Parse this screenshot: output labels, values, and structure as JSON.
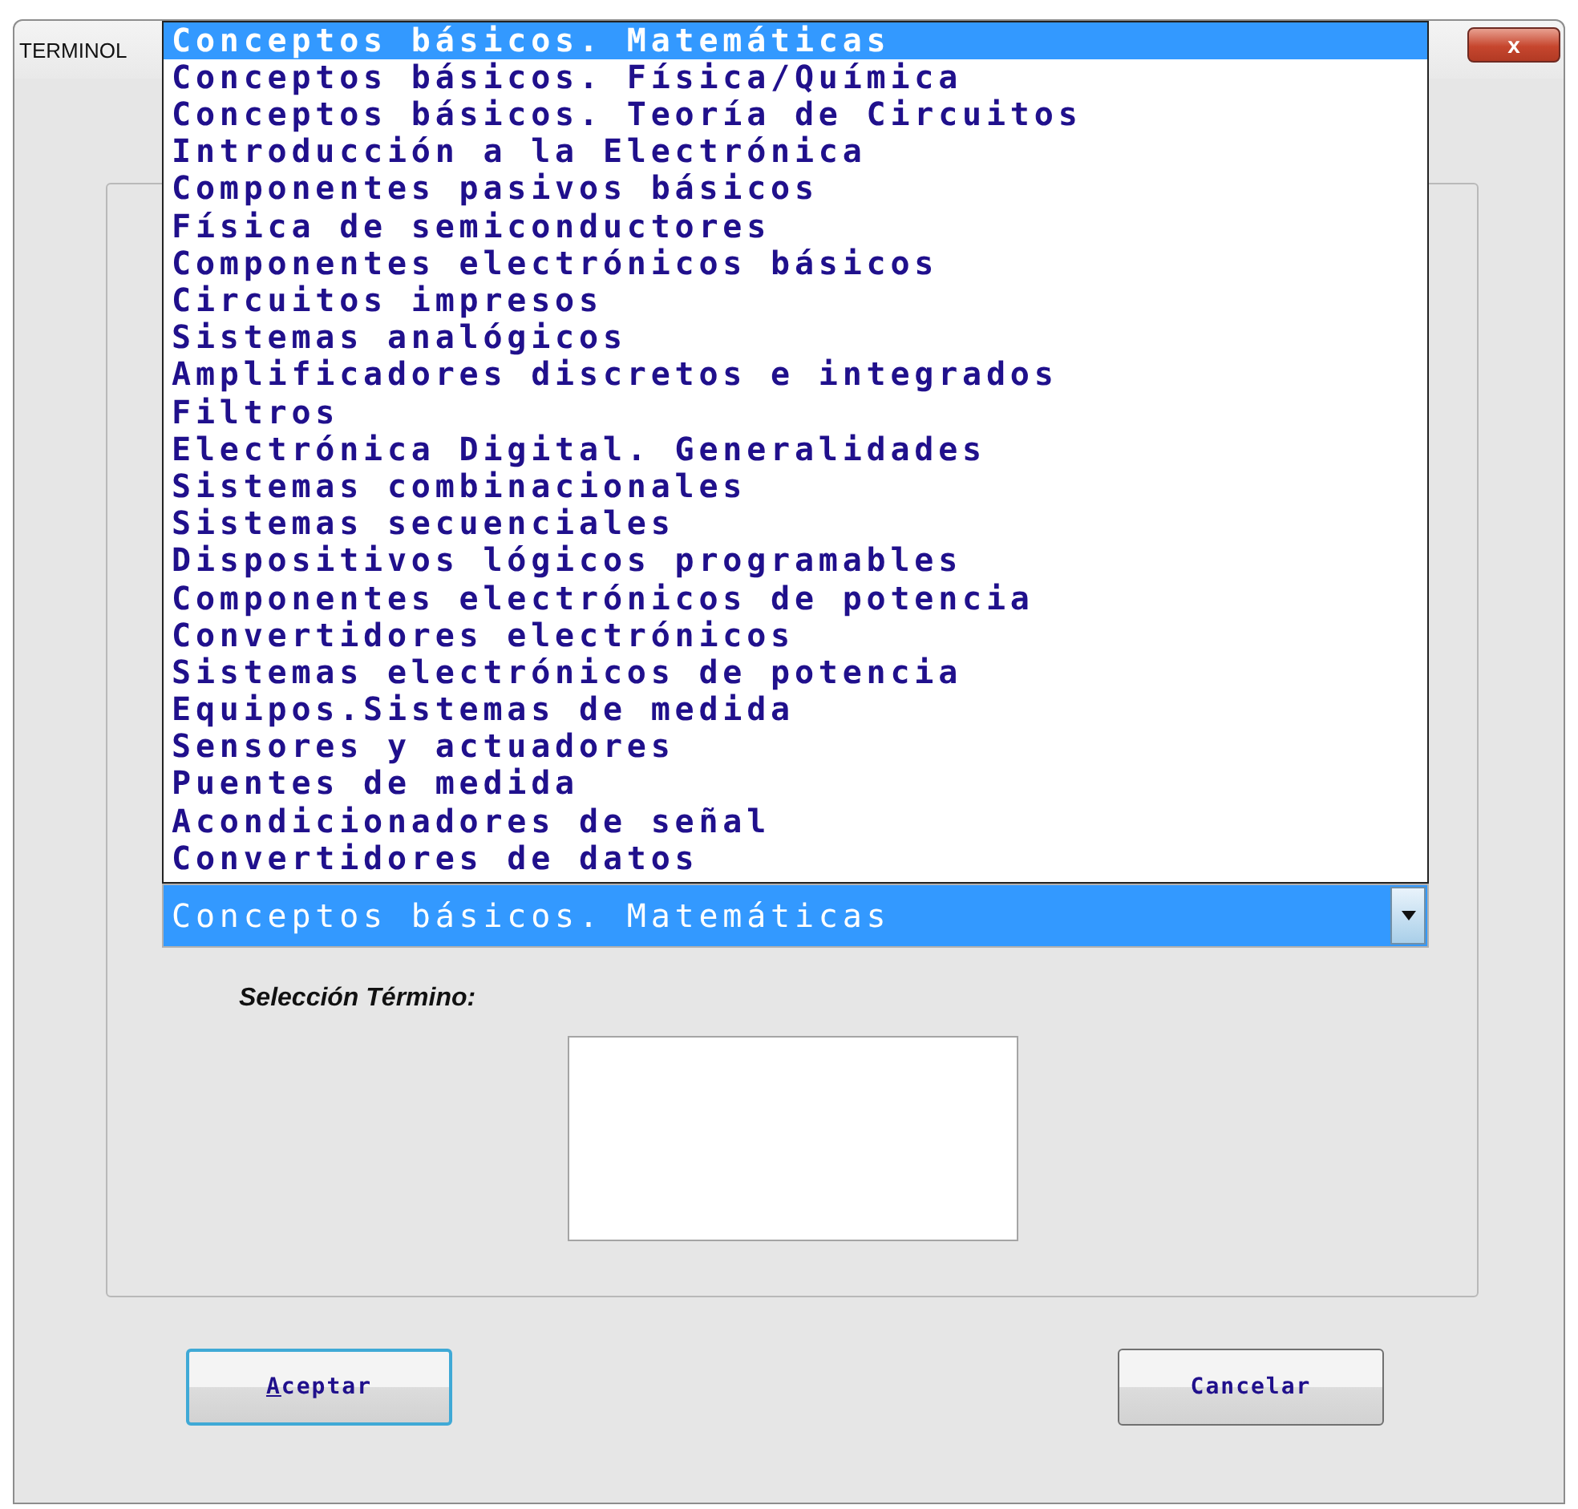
{
  "window": {
    "title": "TERMINOL",
    "close": "x"
  },
  "category_dropdown": {
    "value": "Conceptos básicos. Matemáticas",
    "expanded": true,
    "options": [
      {
        "label": "Conceptos básicos. Matemáticas",
        "selected": true
      },
      {
        "label": "Conceptos básicos. Física/Química",
        "selected": false
      },
      {
        "label": "Conceptos básicos. Teoría de Circuitos",
        "selected": false
      },
      {
        "label": "Introducción a la Electrónica",
        "selected": false
      },
      {
        "label": "Componentes pasivos básicos",
        "selected": false
      },
      {
        "label": "Física de semiconductores",
        "selected": false
      },
      {
        "label": "Componentes electrónicos básicos",
        "selected": false
      },
      {
        "label": "Circuitos impresos",
        "selected": false
      },
      {
        "label": "Sistemas analógicos",
        "selected": false
      },
      {
        "label": "Amplificadores discretos e integrados",
        "selected": false
      },
      {
        "label": "Filtros",
        "selected": false
      },
      {
        "label": "Electrónica Digital. Generalidades",
        "selected": false
      },
      {
        "label": "Sistemas combinacionales",
        "selected": false
      },
      {
        "label": "Sistemas secuenciales",
        "selected": false
      },
      {
        "label": "Dispositivos lógicos programables",
        "selected": false
      },
      {
        "label": "Componentes electrónicos de potencia",
        "selected": false
      },
      {
        "label": "Convertidores electrónicos",
        "selected": false
      },
      {
        "label": "Sistemas electrónicos de potencia",
        "selected": false
      },
      {
        "label": "Equipos.Sistemas de medida",
        "selected": false
      },
      {
        "label": "Sensores y actuadores",
        "selected": false
      },
      {
        "label": "Puentes de medida",
        "selected": false
      },
      {
        "label": "Acondicionadores de señal",
        "selected": false
      },
      {
        "label": "Convertidores de datos",
        "selected": false
      }
    ]
  },
  "term_label": "Selección Término:",
  "buttons": [
    {
      "label": "Aceptar",
      "kind": "default",
      "mnemonic": true
    },
    {
      "label": "Cancelar",
      "kind": "normal",
      "mnemonic": false
    }
  ]
}
